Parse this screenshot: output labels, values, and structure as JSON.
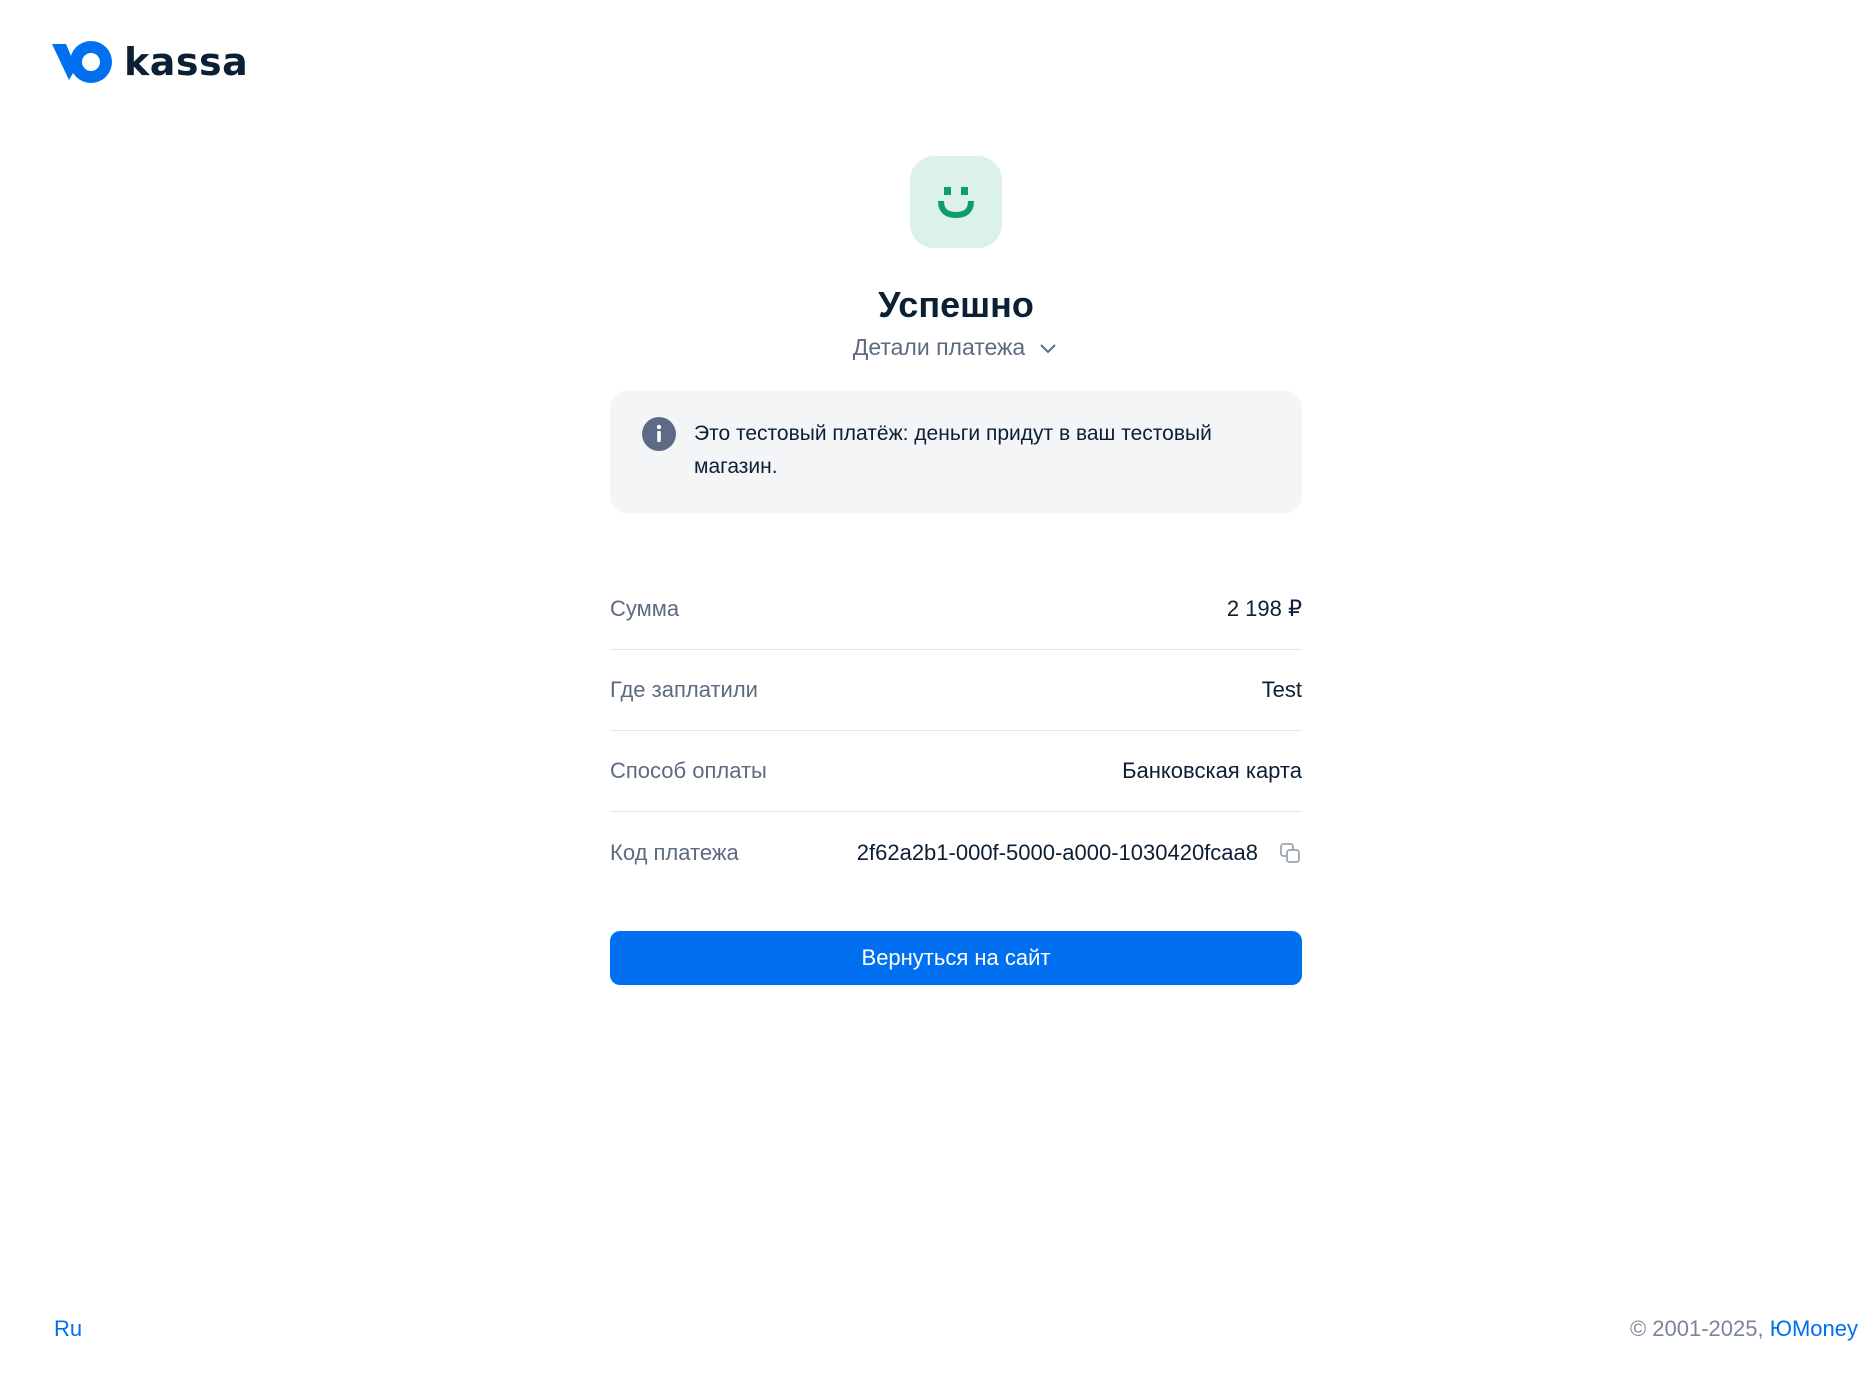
{
  "brand": {
    "logo_text": "kassa",
    "accent_color": "#0070f0"
  },
  "status": {
    "icon": "smile-icon",
    "title": "Успешно",
    "details_toggle_label": "Детали платежа"
  },
  "notice": {
    "icon": "info-icon",
    "text": "Это тестовый платёж: деньги придут в ваш тестовый магазин."
  },
  "details": {
    "rows": [
      {
        "label": "Сумма",
        "value": "2 198 ₽"
      },
      {
        "label": "Где заплатили",
        "value": "Test"
      },
      {
        "label": "Способ оплаты",
        "value": "Банковская карта"
      },
      {
        "label": "Код платежа",
        "value": "2f62a2b1-000f-5000-a000-1030420fcaa8",
        "icon": "copy-icon"
      }
    ]
  },
  "actions": {
    "return_label": "Вернуться на сайт"
  },
  "footer": {
    "language": "Ru",
    "copyright": "© 2001-2025, ",
    "company_link": "ЮMoney"
  }
}
